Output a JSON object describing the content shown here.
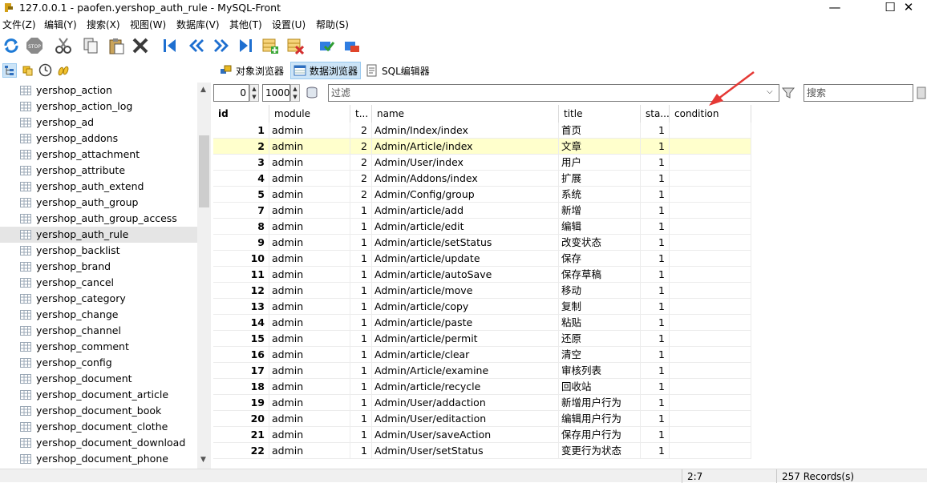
{
  "window": {
    "title": "127.0.0.1 - paofen.yershop_auth_rule - MySQL-Front",
    "minimize": "—",
    "maximize": "☐",
    "close": "✕"
  },
  "menu": [
    "文件(Z)",
    "编辑(Y)",
    "搜索(X)",
    "视图(W)",
    "数据库(V)",
    "其他(T)",
    "设置(U)",
    "帮助(S)"
  ],
  "tabs": {
    "object_browser": "对象浏览器",
    "data_browser": "数据浏览器",
    "sql_editor": "SQL编辑器"
  },
  "tree": {
    "items": [
      "yershop_action",
      "yershop_action_log",
      "yershop_ad",
      "yershop_addons",
      "yershop_attachment",
      "yershop_attribute",
      "yershop_auth_extend",
      "yershop_auth_group",
      "yershop_auth_group_access",
      "yershop_auth_rule",
      "yershop_backlist",
      "yershop_brand",
      "yershop_cancel",
      "yershop_category",
      "yershop_change",
      "yershop_channel",
      "yershop_comment",
      "yershop_config",
      "yershop_document",
      "yershop_document_article",
      "yershop_document_book",
      "yershop_document_clothe",
      "yershop_document_download",
      "yershop_document_phone"
    ],
    "selected_index": 9
  },
  "filter": {
    "offset": "0",
    "limit": "1000",
    "filter_placeholder": "过滤",
    "search_placeholder": "搜索"
  },
  "grid": {
    "columns": [
      "id",
      "module",
      "t...",
      "name",
      "title",
      "sta...",
      "condition"
    ],
    "selected_row": 1,
    "rows": [
      [
        "1",
        "admin",
        "2",
        "Admin/Index/index",
        "首页",
        "1"
      ],
      [
        "2",
        "admin",
        "2",
        "Admin/Article/index",
        "文章",
        "1"
      ],
      [
        "3",
        "admin",
        "2",
        "Admin/User/index",
        "用户",
        "1"
      ],
      [
        "4",
        "admin",
        "2",
        "Admin/Addons/index",
        "扩展",
        "1"
      ],
      [
        "5",
        "admin",
        "2",
        "Admin/Config/group",
        "系统",
        "1"
      ],
      [
        "7",
        "admin",
        "1",
        "Admin/article/add",
        "新增",
        "1"
      ],
      [
        "8",
        "admin",
        "1",
        "Admin/article/edit",
        "编辑",
        "1"
      ],
      [
        "9",
        "admin",
        "1",
        "Admin/article/setStatus",
        "改变状态",
        "1"
      ],
      [
        "10",
        "admin",
        "1",
        "Admin/article/update",
        "保存",
        "1"
      ],
      [
        "11",
        "admin",
        "1",
        "Admin/article/autoSave",
        "保存草稿",
        "1"
      ],
      [
        "12",
        "admin",
        "1",
        "Admin/article/move",
        "移动",
        "1"
      ],
      [
        "13",
        "admin",
        "1",
        "Admin/article/copy",
        "复制",
        "1"
      ],
      [
        "14",
        "admin",
        "1",
        "Admin/article/paste",
        "粘贴",
        "1"
      ],
      [
        "15",
        "admin",
        "1",
        "Admin/article/permit",
        "还原",
        "1"
      ],
      [
        "16",
        "admin",
        "1",
        "Admin/article/clear",
        "清空",
        "1"
      ],
      [
        "17",
        "admin",
        "1",
        "Admin/Article/examine",
        "审核列表",
        "1"
      ],
      [
        "18",
        "admin",
        "1",
        "Admin/article/recycle",
        "回收站",
        "1"
      ],
      [
        "19",
        "admin",
        "1",
        "Admin/User/addaction",
        "新增用户行为",
        "1"
      ],
      [
        "20",
        "admin",
        "1",
        "Admin/User/editaction",
        "编辑用户行为",
        "1"
      ],
      [
        "21",
        "admin",
        "1",
        "Admin/User/saveAction",
        "保存用户行为",
        "1"
      ],
      [
        "22",
        "admin",
        "1",
        "Admin/User/setStatus",
        "变更行为状态",
        "1"
      ]
    ]
  },
  "status": {
    "cursor": "2:7",
    "records": "257 Records(s)"
  },
  "colors": {
    "selection_row": "#ffffcc",
    "active_tab": "#cce4f7",
    "annotation_arrow": "#e53935"
  }
}
